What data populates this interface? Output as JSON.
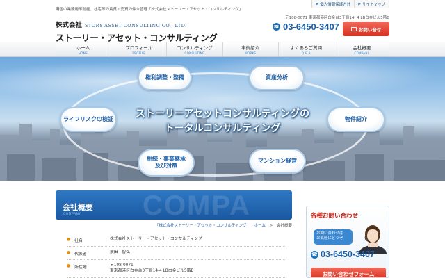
{
  "header": {
    "tagline": "港区の業務用不動産、社宅等の賃貸・売買の仲介管理「株式会社ストーリー・アセット・コンサルティング」",
    "util_links": [
      "個人情報保護方針",
      "サイトマップ"
    ],
    "logo": {
      "kk": "株式会社",
      "en": "STORY ASSET CONSULTING CO., LTD.",
      "jp": "ストーリー・アセット・コンサルティング"
    },
    "address": "〒108-0071 東京都港区白金台3丁目14- 4 LB白金ビル5階B",
    "phone": "03-6450-3407",
    "contact_button": "お問い合せ"
  },
  "nav": [
    {
      "ja": "ホーム",
      "en": "HOME"
    },
    {
      "ja": "プロフィール",
      "en": "PROFILE"
    },
    {
      "ja": "コンサルティング",
      "en": "CONSULTING"
    },
    {
      "ja": "事例紹介",
      "en": "WORKS"
    },
    {
      "ja": "よくあるご質問",
      "en": "Q & A"
    },
    {
      "ja": "会社概要",
      "en": "COMPANY"
    }
  ],
  "hero": {
    "line1": "ストーリーアセットコンサルティングの",
    "line2": "トータルコンサルティング",
    "pills": [
      "権利調整・整備",
      "資産分析",
      "ライフリスクの検証",
      "物件紹介",
      "相続・事業継承\n及び対策",
      "マンション経営"
    ]
  },
  "section": {
    "title": "会社概要",
    "subtitle": "COMPANY",
    "watermark": "COMPA"
  },
  "breadcrumb": {
    "link": "「株式会社ストーリー・アセット・コンサルティング」｜ホーム",
    "sep": ">",
    "current": "会社概要"
  },
  "company": [
    {
      "label": "社名",
      "value": "株式会社ストーリー・アセット・コンサルティング"
    },
    {
      "label": "代表者",
      "value": "濱田　智弘"
    },
    {
      "label": "所在地",
      "value": "〒108-0071\n東京都港区白金台3丁目14-4 LB白金ビル5階B"
    }
  ],
  "sidebar": {
    "title": "各種お問い合わせ",
    "bubble": "お問い合わせは\nお気軽にどうぞ",
    "phone": "03-6450-3407",
    "form_button": "お問い合わせフォーム"
  },
  "colors": {
    "brand_blue": "#1d5fa3",
    "accent_red": "#d8301f",
    "nav_en": "#3b82c4"
  }
}
